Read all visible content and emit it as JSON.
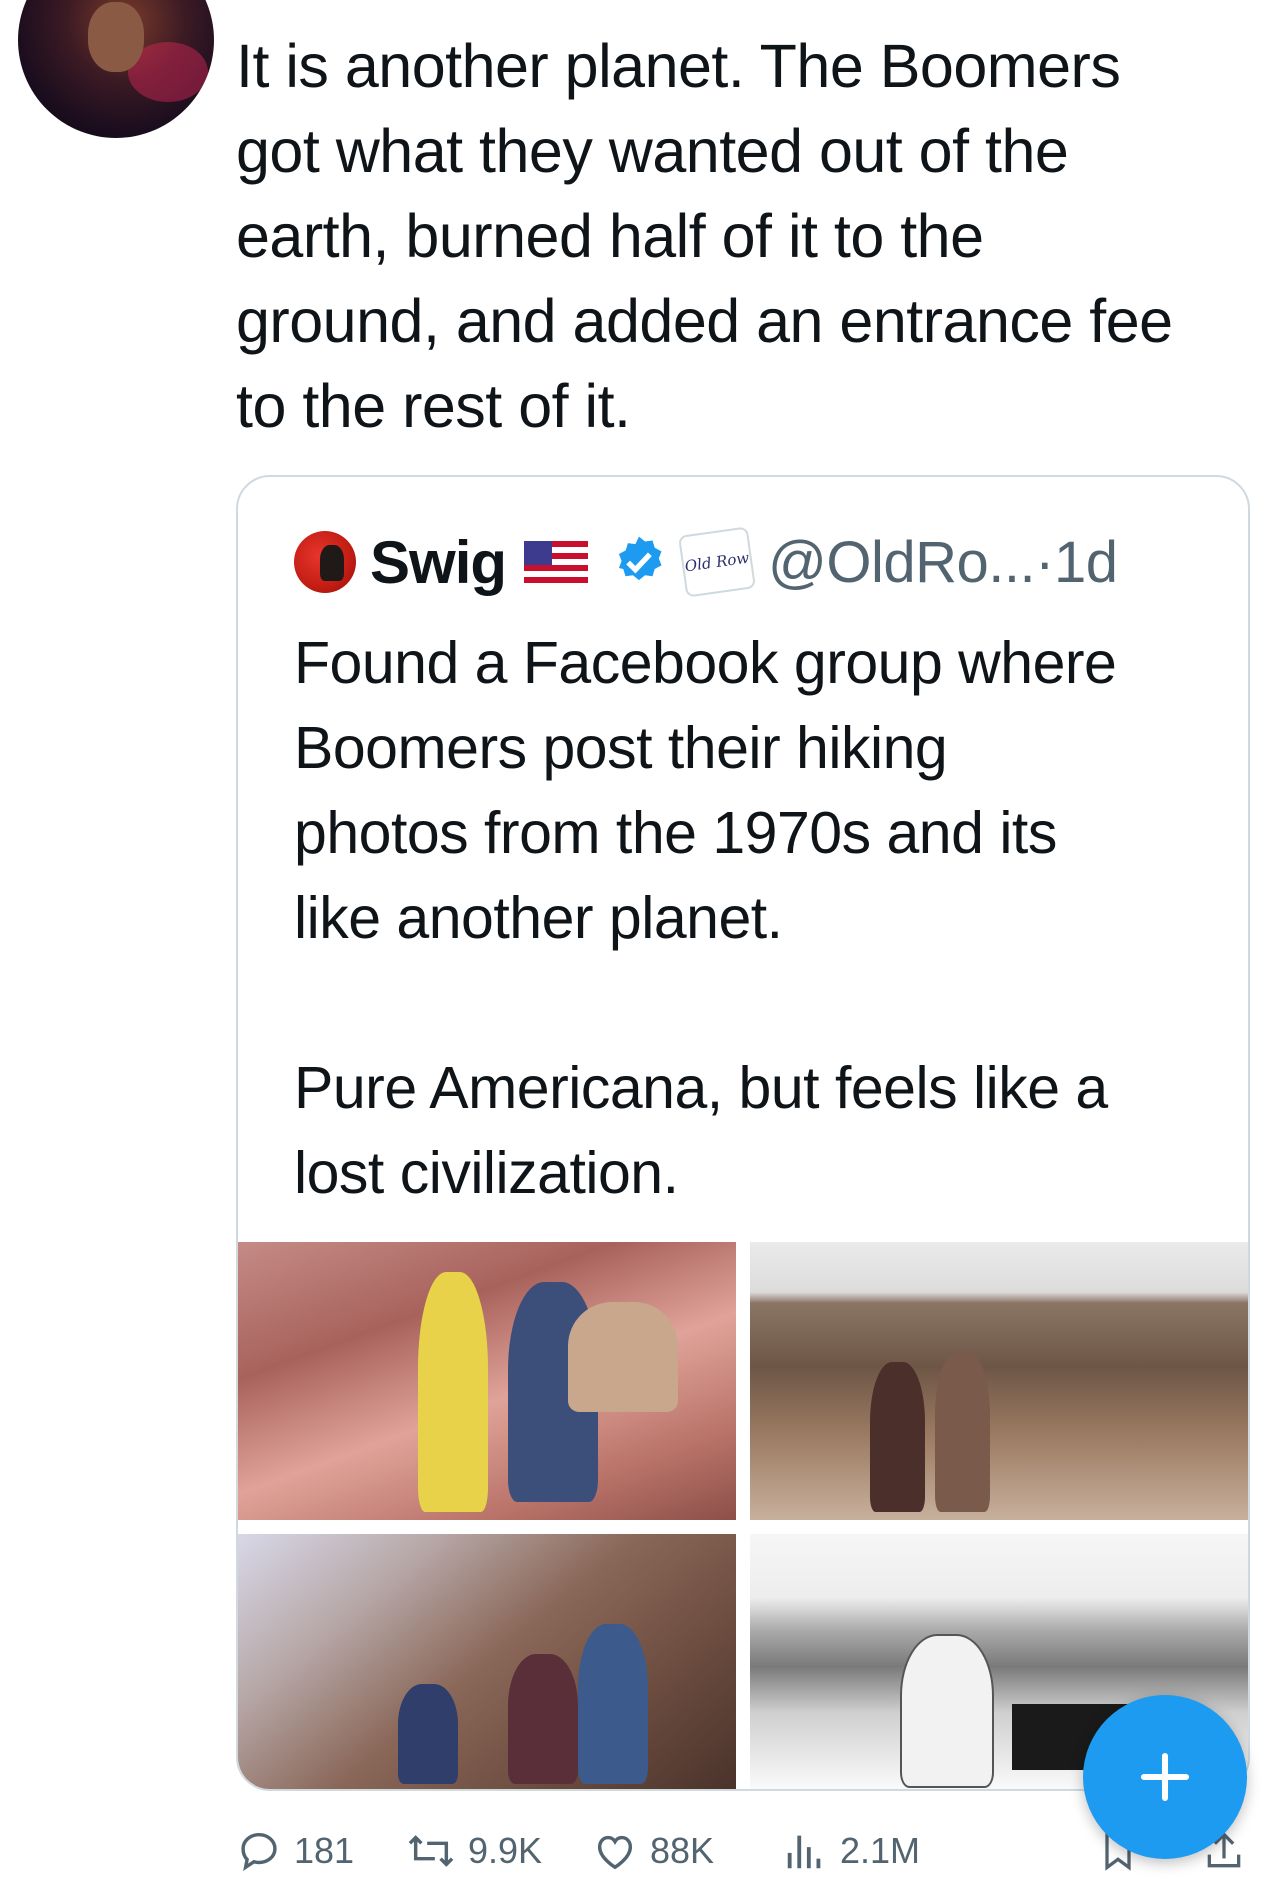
{
  "tweet": {
    "text": "It is another planet. The Boomers\ngot what they wanted out of the\nearth, burned half of it to the\nground, and added an entrance fee\nto the rest of it."
  },
  "quote": {
    "name": "Swig",
    "affiliate_label": "Old Row",
    "handle_time": "@OldRo...·1d",
    "text": "Found a Facebook group where\nBoomers post their hiking\nphotos from the 1970s and its\nlike another planet.\n\nPure Americana, but feels like a\nlost civilization."
  },
  "actions": {
    "replies": "181",
    "reposts": "9.9K",
    "likes": "88K",
    "views": "2.1M"
  },
  "colors": {
    "accent": "#1d9bf0",
    "muted": "#536471",
    "border": "#cfd9de"
  },
  "icons": [
    "reply-icon",
    "repost-icon",
    "like-icon",
    "views-icon",
    "bookmark-icon",
    "share-icon",
    "plus-icon",
    "verified-badge-icon",
    "us-flag-icon"
  ]
}
